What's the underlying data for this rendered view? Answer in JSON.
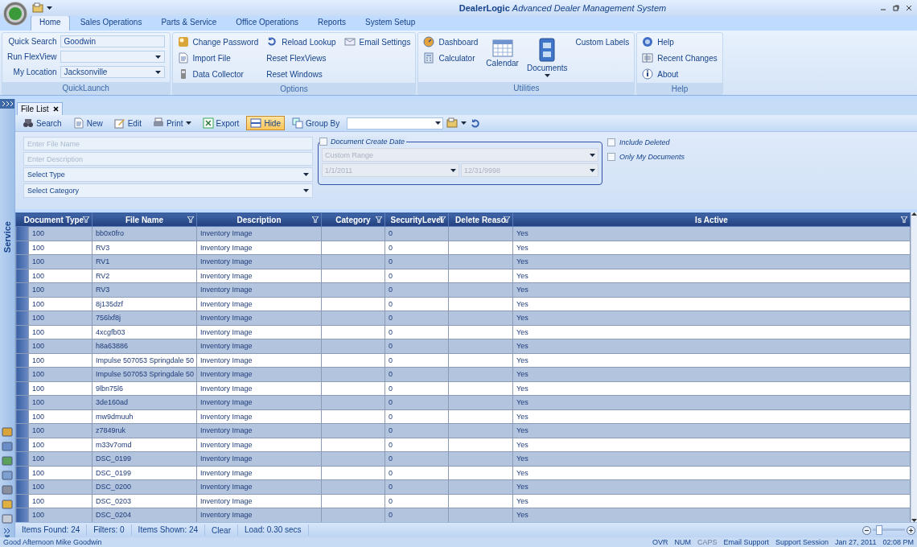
{
  "window": {
    "title": "**DealerLogic** *Advanced Dealer Management System*"
  },
  "ribbon_tabs": [
    {
      "label": "Home",
      "selected": true
    },
    {
      "label": "Sales Operations",
      "selected": false
    },
    {
      "label": "Parts & Service",
      "selected": false
    },
    {
      "label": "Office Operations",
      "selected": false
    },
    {
      "label": "Reports",
      "selected": false
    },
    {
      "label": "System Setup",
      "selected": false
    }
  ],
  "ribbon_groups": [
    {
      "title": "QuickLaunch",
      "columns": [
        [
          {
            "kind": "field",
            "label": "Quick Search",
            "value": "Goodwin",
            "dropdown": false
          },
          {
            "kind": "field",
            "label": "Run FlexView",
            "dropdown": true
          },
          {
            "kind": "field",
            "label": "My Location",
            "value": "Jacksonville",
            "dropdown": true
          }
        ]
      ]
    },
    {
      "title": "Options",
      "columns": [
        [
          {
            "kind": "small",
            "label": "Change Password"
          },
          {
            "kind": "small",
            "label": "Import File"
          },
          {
            "kind": "small",
            "label": "Data Collector"
          }
        ],
        [
          {
            "kind": "small",
            "label": "Reload Lookup"
          },
          {
            "kind": "plain",
            "label": "Reset FlexViews"
          },
          {
            "kind": "plain",
            "label": "Reset Windows"
          }
        ],
        [
          {
            "kind": "small",
            "label": "Email Settings"
          }
        ]
      ]
    },
    {
      "title": "Utilities",
      "columns": [
        [
          {
            "kind": "small",
            "label": "Dashboard"
          },
          {
            "kind": "small",
            "label": "Calculator"
          }
        ],
        [
          {
            "kind": "large",
            "label": "Calendar"
          }
        ],
        [
          {
            "kind": "large_menu",
            "label": "Documents"
          }
        ],
        [
          {
            "kind": "plain",
            "label": "Custom Labels"
          }
        ]
      ]
    },
    {
      "title": "Help",
      "columns": [
        [
          {
            "kind": "small",
            "label": "Help"
          },
          {
            "kind": "small",
            "label": "Recent Changes"
          },
          {
            "kind": "small",
            "label": "About"
          }
        ]
      ]
    }
  ],
  "side_panel": {
    "label": "Service"
  },
  "document_tabs": [
    {
      "label": "File List",
      "selected": true
    }
  ],
  "toolbar": [
    {
      "label": "Search",
      "pressed": false,
      "menu": false
    },
    {
      "label": "New",
      "pressed": false,
      "menu": false
    },
    {
      "label": "Edit",
      "pressed": false,
      "menu": false
    },
    {
      "label": "Print",
      "pressed": false,
      "menu": true
    },
    {
      "label": "Export",
      "pressed": false,
      "menu": false
    },
    {
      "label": "Hide",
      "pressed": true,
      "menu": false
    },
    {
      "label": "Group By",
      "pressed": false,
      "menu": false
    }
  ],
  "filters": {
    "file_name": {
      "placeholder": "Enter File Name"
    },
    "description": {
      "placeholder": "Enter Description"
    },
    "type": {
      "value": "Select Type"
    },
    "category": {
      "value": "Select Category"
    },
    "create_date": {
      "label": "Document Create Date",
      "checked": false,
      "range": "Custom Range",
      "from": "1/1/2011",
      "to": "12/31/9998"
    },
    "options": [
      {
        "label": "Include Deleted",
        "checked": false
      },
      {
        "label": "Only My Documents",
        "checked": false
      }
    ]
  },
  "table": {
    "columns": [
      "Document Type",
      "File Name",
      "Description",
      "Category",
      "SecurityLevel",
      "Delete Reaso",
      "Is Active"
    ],
    "rows": [
      [
        "100",
        "bb0x0fro",
        "Inventory Image",
        "",
        "0",
        "",
        "Yes"
      ],
      [
        "100",
        "RV3",
        "Inventory Image",
        "",
        "0",
        "",
        "Yes"
      ],
      [
        "100",
        "RV1",
        "Inventory Image",
        "",
        "0",
        "",
        "Yes"
      ],
      [
        "100",
        "RV2",
        "Inventory Image",
        "",
        "0",
        "",
        "Yes"
      ],
      [
        "100",
        "RV3",
        "Inventory Image",
        "",
        "0",
        "",
        "Yes"
      ],
      [
        "100",
        "8j135dzf",
        "Inventory Image",
        "",
        "0",
        "",
        "Yes"
      ],
      [
        "100",
        "756lxf8j",
        "Inventory Image",
        "",
        "0",
        "",
        "Yes"
      ],
      [
        "100",
        "4xcgfb03",
        "Inventory Image",
        "",
        "0",
        "",
        "Yes"
      ],
      [
        "100",
        "h8a63886",
        "Inventory Image",
        "",
        "0",
        "",
        "Yes"
      ],
      [
        "100",
        "Impulse 507053 Springdale 50",
        "Inventory Image",
        "",
        "0",
        "",
        "Yes"
      ],
      [
        "100",
        "Impulse 507053 Springdale 50",
        "Inventory Image",
        "",
        "0",
        "",
        "Yes"
      ],
      [
        "100",
        "9lbn75l6",
        "Inventory Image",
        "",
        "0",
        "",
        "Yes"
      ],
      [
        "100",
        "3de160ad",
        "Inventory Image",
        "",
        "0",
        "",
        "Yes"
      ],
      [
        "100",
        "mw9dmuuh",
        "Inventory Image",
        "",
        "0",
        "",
        "Yes"
      ],
      [
        "100",
        "z7849ruk",
        "Inventory Image",
        "",
        "0",
        "",
        "Yes"
      ],
      [
        "100",
        "m33v7omd",
        "Inventory Image",
        "",
        "0",
        "",
        "Yes"
      ],
      [
        "100",
        "DSC_0199",
        "Inventory Image",
        "",
        "0",
        "",
        "Yes"
      ],
      [
        "100",
        "DSC_0199",
        "Inventory Image",
        "",
        "0",
        "",
        "Yes"
      ],
      [
        "100",
        "DSC_0200",
        "Inventory Image",
        "",
        "0",
        "",
        "Yes"
      ],
      [
        "100",
        "DSC_0203",
        "Inventory Image",
        "",
        "0",
        "",
        "Yes"
      ],
      [
        "100",
        "DSC_0204",
        "Inventory Image",
        "",
        "0",
        "",
        "Yes"
      ]
    ]
  },
  "footer": {
    "items": [
      "Items Found: 24",
      "Filters: 0",
      "Items Shown: 24"
    ],
    "clear": "Clear",
    "load": "Load: 0.30 secs",
    "zoom": {
      "level": 0.1
    }
  },
  "status_bar": {
    "greeting": "Good Afternoon Mike Goodwin",
    "indicators": [
      {
        "label": "OVR",
        "on": true
      },
      {
        "label": "NUM",
        "on": true
      },
      {
        "label": "CAPS",
        "on": false
      }
    ],
    "links": [
      "Email Support",
      "Support Session"
    ],
    "date": "Jan 27, 2011",
    "time": "02:08 PM"
  }
}
